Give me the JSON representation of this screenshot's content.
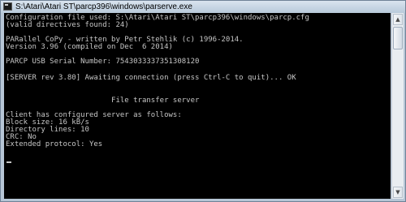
{
  "window": {
    "title": "S:\\Atari\\Atari ST\\parcp396\\windows\\parserve.exe",
    "icon": "console-app-icon"
  },
  "console": {
    "lines": [
      "Configuration file used: S:\\Atari\\Atari ST\\parcp396\\windows\\parcp.cfg",
      "(valid directives found: 24)",
      "PARallel CoPy - written by Petr Stehlik (c) 1996-2014.",
      "Version 3.96 (compiled on Dec  6 2014)",
      "PARCP USB Serial Number: 7543033337351308120",
      "[SERVER rev 3.80] Awaiting connection (press Ctrl-C to quit)... OK",
      "                        File transfer server",
      "Client has configured server as follows:",
      "Block size: 16 kB/s",
      "Directory lines: 10",
      "CRC: No",
      "Extended protocol: Yes"
    ]
  },
  "scrollbar": {
    "up_icon": "▲",
    "down_icon": "▼"
  }
}
